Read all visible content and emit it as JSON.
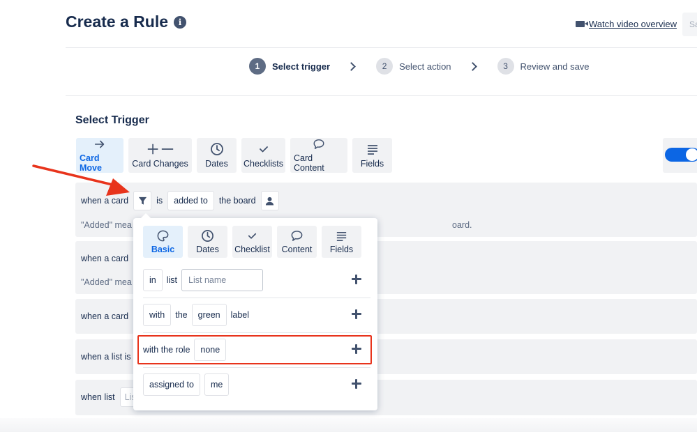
{
  "header": {
    "title": "Create a Rule",
    "info_icon": "info-icon",
    "watch_link": "Watch video overview",
    "watch_icon": "video-camera-icon",
    "save_cut": "Sa"
  },
  "steps": [
    {
      "num": "1",
      "label": "Select trigger",
      "active": true
    },
    {
      "num": "2",
      "label": "Select action",
      "active": false
    },
    {
      "num": "3",
      "label": "Review and save",
      "active": false
    }
  ],
  "section_title": "Select Trigger",
  "trigger_tabs": [
    {
      "label": "Card Move",
      "icon": "arrow-right-icon",
      "active": true
    },
    {
      "label": "Card Changes",
      "icon": "plus-minus-icon",
      "active": false
    },
    {
      "label": "Dates",
      "icon": "clock-icon",
      "active": false
    },
    {
      "label": "Checklists",
      "icon": "checkmark-icon",
      "active": false
    },
    {
      "label": "Card Content",
      "icon": "speech-bubble-icon",
      "active": false
    },
    {
      "label": "Fields",
      "icon": "lines-icon",
      "active": false
    }
  ],
  "rows": {
    "r1": {
      "prefix": "when a card",
      "is": "is",
      "action": "added to",
      "target": "the board",
      "desc": "\"Added\" mea",
      "desc_tail": "oard."
    },
    "r2": {
      "prefix": "when a card",
      "desc": "\"Added\" mea"
    },
    "r3": {
      "prefix": "when a card"
    },
    "r4": {
      "prefix": "when a list is"
    },
    "r5": {
      "prefix": "when list",
      "input_cut": "Lis"
    }
  },
  "popup": {
    "tabs": [
      {
        "label": "Basic",
        "icon": "palette-icon",
        "active": true
      },
      {
        "label": "Dates",
        "icon": "clock-icon",
        "active": false
      },
      {
        "label": "Checklist",
        "icon": "checkmark-icon",
        "active": false
      },
      {
        "label": "Content",
        "icon": "speech-bubble-icon",
        "active": false
      },
      {
        "label": "Fields",
        "icon": "lines-icon",
        "active": false
      }
    ],
    "filter1": {
      "in": "in",
      "list": "list",
      "placeholder": "List name"
    },
    "filter2": {
      "with": "with",
      "the": "the",
      "color": "green",
      "label": "label"
    },
    "filter3": {
      "text": "with the role",
      "value": "none"
    },
    "filter4": {
      "text": "assigned to",
      "value": "me"
    }
  },
  "colors": {
    "accent": "#0c66e4",
    "highlight": "#e8341c",
    "arrow": "#e8341c"
  }
}
